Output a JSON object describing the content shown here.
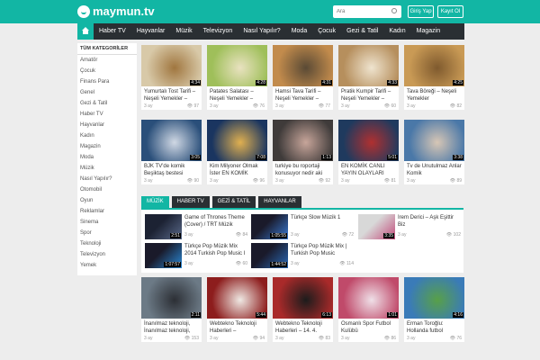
{
  "header": {
    "logo": "maymun.tv",
    "search_placeholder": "Ara",
    "login": "Giriş Yap",
    "signup": "Kayıt Ol"
  },
  "nav": [
    "Haber TV",
    "Hayvanlar",
    "Müzik",
    "Televizyon",
    "Nasıl Yapılır?",
    "Moda",
    "Çocuk",
    "Gezi & Tatil",
    "Kadın",
    "Magazin"
  ],
  "sidebar": {
    "heading": "TÜM KATEGORİLER",
    "items": [
      "Amatör",
      "Çocuk",
      "Finans Para",
      "Genel",
      "Gezi & Tatil",
      "Haber TV",
      "Hayvanlar",
      "Kadın",
      "Magazin",
      "Moda",
      "Müzik",
      "Nasıl Yapılır?",
      "Otomobil",
      "Oyun",
      "Reklamlar",
      "Sinema",
      "Spor",
      "Teknoloji",
      "Televizyon",
      "Yemek"
    ]
  },
  "row1": [
    {
      "title": "Yumurtalı Tost Tarifi – Neşeli Yemekler –",
      "dur": "4:34",
      "age": "3 ay",
      "views": "97"
    },
    {
      "title": "Patates Salatası – Neşeli Yemekler –",
      "dur": "4:28",
      "age": "3 ay",
      "views": "76"
    },
    {
      "title": "Hamsi Tava Tarifi – Neşeli Yemekler –",
      "dur": "4:31",
      "age": "3 ay",
      "views": "77"
    },
    {
      "title": "Pratik Kumpir Tarifi – Neşeli Yemekler –",
      "dur": "4:33",
      "age": "3 ay",
      "views": "60"
    },
    {
      "title": "Tava Böreği – Neşeli Yemekler",
      "dur": "4:25",
      "age": "3 ay",
      "views": "82"
    }
  ],
  "row2": [
    {
      "title": "BJK TV'de komik Beşiktaş bestesi",
      "dur": "3:05",
      "age": "3 ay",
      "views": "90"
    },
    {
      "title": "Kim Milyoner Olmak İster EN KOMİK",
      "dur": "7:08",
      "age": "3 ay",
      "views": "96"
    },
    {
      "title": "turkiye bu roportaji konusuyor nedir aki",
      "dur": "1:13",
      "age": "3 ay",
      "views": "92"
    },
    {
      "title": "EN KOMİK CANLI YAYIN OLAYLARI",
      "dur": "5:01",
      "age": "3 ay",
      "views": "81"
    },
    {
      "title": "Tv de Unutulmaz Anlar Komik",
      "dur": "3:38",
      "age": "3 ay",
      "views": "89"
    }
  ],
  "tabs": [
    "MÜZİK",
    "HABER TV",
    "GEZİ & TATİL",
    "HAYVANLAR"
  ],
  "tab_items": [
    {
      "title": "Game of Thrones Theme (Cover) / TRT Müzik",
      "dur": "2:51",
      "age": "3 ay",
      "views": "84"
    },
    {
      "title": "Türkçe Slow Müzik 1",
      "dur": "1:05:55",
      "age": "3 ay",
      "views": "72"
    },
    {
      "title": "İrem Derici – Aşk Eşittir Biz",
      "dur": "3:35",
      "age": "3 ay",
      "views": "102"
    },
    {
      "title": "Türkçe Pop Müzik Mix 2014 Turkish Pop Music I",
      "dur": "1:07:57",
      "age": "3 ay",
      "views": "60"
    },
    {
      "title": "Türkçe Pop Müzik Mix | Turkish Pop Music",
      "dur": "1:44:52",
      "age": "3 ay",
      "views": "114"
    }
  ],
  "row3": [
    {
      "title": "İnanılmaz teknoloji, İnanılmaz teknoloji,",
      "dur": "2:11",
      "age": "3 ay",
      "views": "153"
    },
    {
      "title": "Webtekno Teknoloji Haberleri – 17.02.2014",
      "dur": "5:44",
      "age": "3 ay",
      "views": "94"
    },
    {
      "title": "Webtekno Teknoloji Haberleri – 14. 4. 2014",
      "dur": "6:13",
      "age": "3 ay",
      "views": "83"
    },
    {
      "title": "Osmanlı Spor Futbol Kulübü",
      "dur": "1:01",
      "age": "3 ay",
      "views": "86"
    },
    {
      "title": "Erman Toroğlu: Hollanda futbol",
      "dur": "4:16",
      "age": "3 ay",
      "views": "76"
    }
  ]
}
